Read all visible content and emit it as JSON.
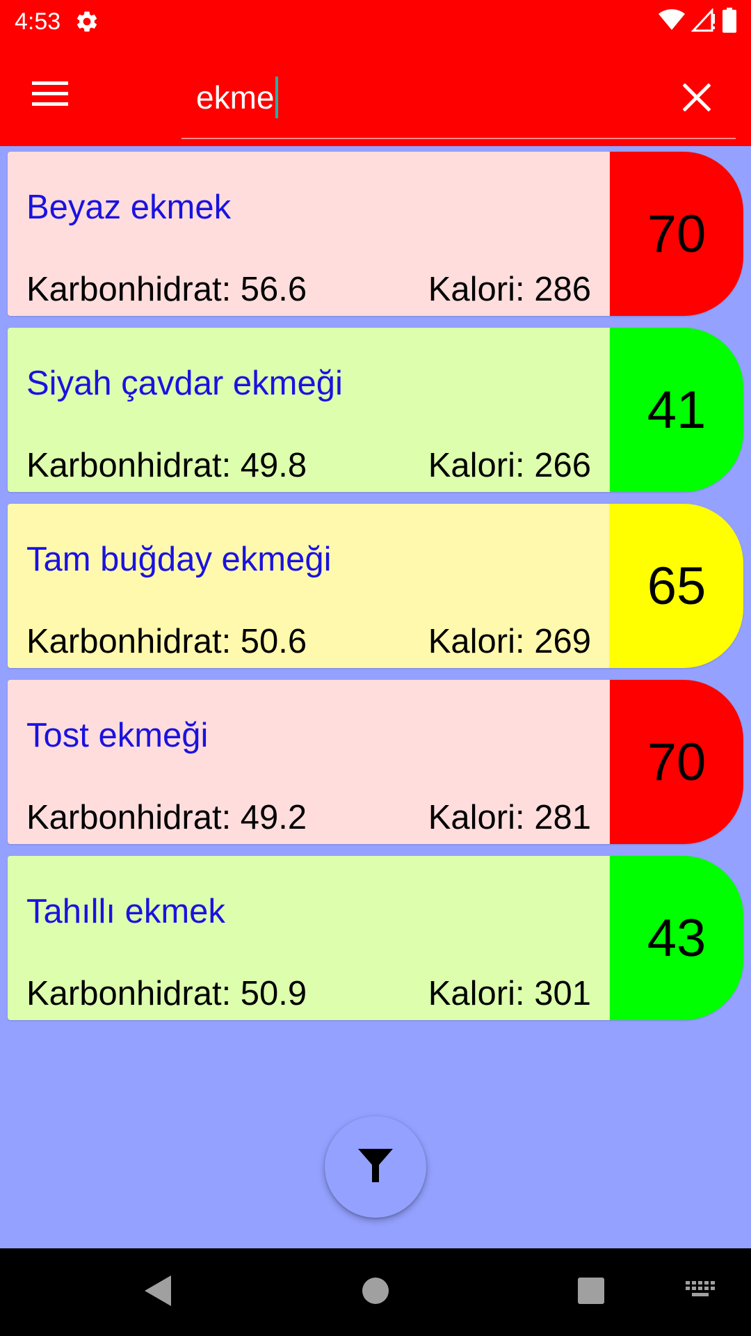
{
  "status_bar": {
    "time": "4:53"
  },
  "search": {
    "value": "ekme",
    "placeholder": ""
  },
  "colors": {
    "app_bar": "#ff0000",
    "background": "#94a1ff",
    "name_text": "#1a12e0",
    "caret": "#21b2a6",
    "gi_high": "#ff0000",
    "gi_medium": "#ffff00",
    "gi_low": "#00ff00",
    "card_high": "#ffdddd",
    "card_medium": "#fff9ad",
    "card_low": "#ddffad"
  },
  "foods": [
    {
      "name": "Beyaz ekmek",
      "carb": "Karbonhidrat: 56.6",
      "kcal": "Kalori: 286",
      "gi": "70",
      "level": "high"
    },
    {
      "name": "Siyah çavdar ekmeği",
      "carb": "Karbonhidrat: 49.8",
      "kcal": "Kalori: 266",
      "gi": "41",
      "level": "low"
    },
    {
      "name": "Tam buğday ekmeği",
      "carb": "Karbonhidrat: 50.6",
      "kcal": "Kalori: 269",
      "gi": "65",
      "level": "medium"
    },
    {
      "name": "Tost ekmeği",
      "carb": "Karbonhidrat: 49.2",
      "kcal": "Kalori: 281",
      "gi": "70",
      "level": "high"
    },
    {
      "name": "Tahıllı ekmek",
      "carb": "Karbonhidrat: 50.9",
      "kcal": "Kalori: 301",
      "gi": "43",
      "level": "low"
    }
  ],
  "icons": {
    "settings": "gear-icon",
    "wifi": "wifi-icon",
    "signal": "signal-icon",
    "battery": "battery-icon",
    "menu": "hamburger-menu-icon",
    "clear": "close-icon",
    "fab": "filter-icon",
    "back": "back-triangle-icon",
    "home": "home-circle-icon",
    "recents": "recents-square-icon",
    "keyboard": "keyboard-icon"
  }
}
